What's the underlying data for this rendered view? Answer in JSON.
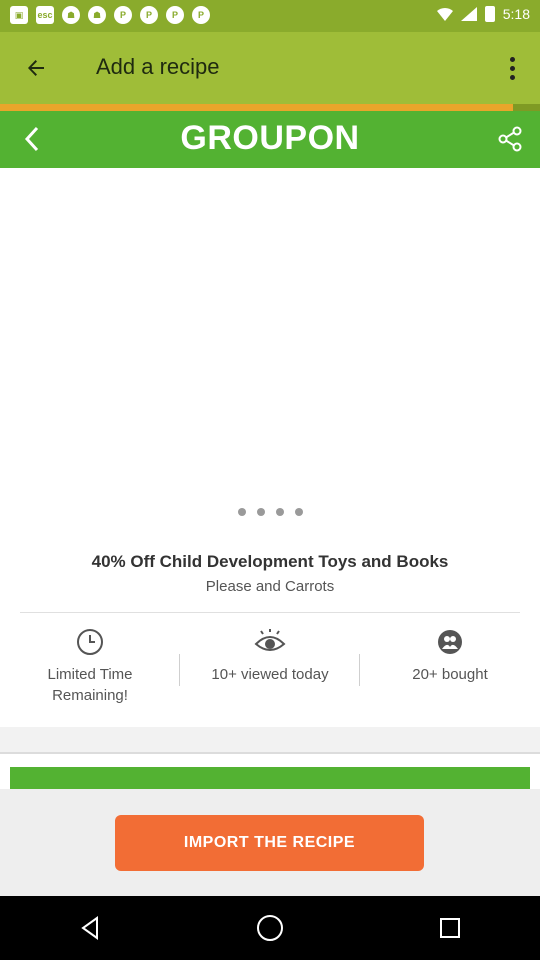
{
  "status_bar": {
    "time": "5:18",
    "notification_icons": [
      "app-icon-1",
      "esc-icon",
      "app-icon-2",
      "app-icon-3",
      "app-icon-4",
      "app-icon-5",
      "app-icon-6",
      "app-icon-7"
    ],
    "esc_label": "esc",
    "colors": {
      "background": "#8aab2c"
    }
  },
  "app_bar": {
    "title": "Add a recipe",
    "back_icon": "arrow-back-icon",
    "menu_icon": "more-vert-icon",
    "colors": {
      "background": "#9fbd38"
    }
  },
  "loading": {
    "progress": 0.95,
    "colors": {
      "track": "#7f9a24",
      "fill": "#e9a52b"
    }
  },
  "groupon": {
    "logo": "GROUPON",
    "back_icon": "chevron-left-icon",
    "share_icon": "share-icon",
    "colors": {
      "brand": "#53b232"
    }
  },
  "deal": {
    "carousel_dots": 4,
    "title": "40% Off Child Development Toys and Books",
    "merchant": "Please and Carrots",
    "stats": [
      {
        "icon": "clock-icon",
        "label": "Limited Time Remaining!"
      },
      {
        "icon": "eye-icon",
        "label": "10+ viewed today"
      },
      {
        "icon": "people-icon",
        "label": "20+ bought"
      }
    ]
  },
  "import": {
    "button_label": "IMPORT THE RECIPE",
    "colors": {
      "button": "#f26d35",
      "panel": "#eeeeee"
    }
  },
  "nav_bar": {
    "buttons": [
      "back-triangle-icon",
      "home-circle-icon",
      "recents-square-icon"
    ]
  }
}
